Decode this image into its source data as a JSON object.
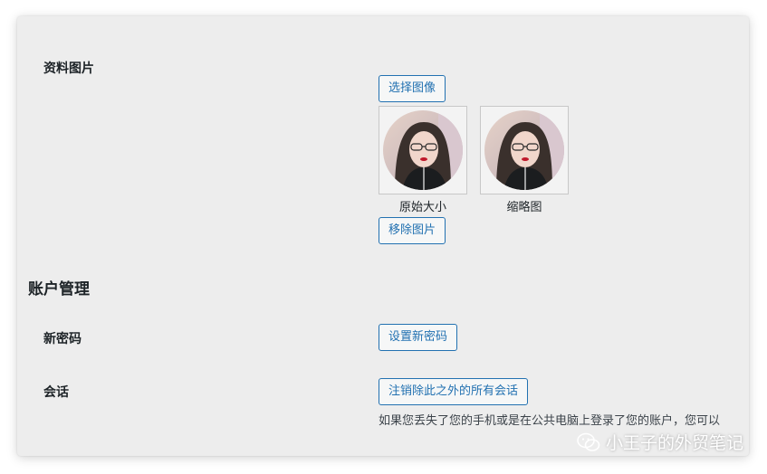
{
  "profile_picture": {
    "label": "资料图片",
    "choose_button": "选择图像",
    "captions": [
      "原始大小",
      "缩略图"
    ],
    "remove_button": "移除图片"
  },
  "account": {
    "section_title": "账户管理",
    "new_password_label": "新密码",
    "set_password_button": "设置新密码",
    "sessions_label": "会话",
    "logout_others_button": "注销除此之外的所有会话",
    "sessions_description": "如果您丢失了您的手机或是在公共电脑上登录了您的账户，您可以"
  },
  "watermark": {
    "icon": "wechat-icon",
    "text": "小王子的外贸笔记"
  }
}
